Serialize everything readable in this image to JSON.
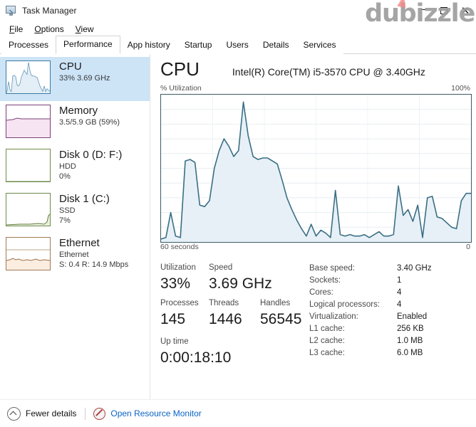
{
  "window": {
    "title": "Task Manager",
    "icon": "task-manager-icon",
    "controls": {
      "minimize": "–",
      "maximize": "❑",
      "close": "✕"
    },
    "watermark": "dubizzle"
  },
  "menu": {
    "items": [
      {
        "label": "File",
        "accel": "F"
      },
      {
        "label": "Options",
        "accel": "O"
      },
      {
        "label": "View",
        "accel": "V"
      }
    ]
  },
  "tabs": [
    {
      "label": "Processes",
      "selected": false
    },
    {
      "label": "Performance",
      "selected": true
    },
    {
      "label": "App history",
      "selected": false
    },
    {
      "label": "Startup",
      "selected": false
    },
    {
      "label": "Users",
      "selected": false
    },
    {
      "label": "Details",
      "selected": false
    },
    {
      "label": "Services",
      "selected": false
    }
  ],
  "sidebar": {
    "items": [
      {
        "name": "CPU",
        "line1": "33%  3.69 GHz",
        "line2": "",
        "selected": true,
        "color": "#3a7ca5",
        "fill": "#e6f0f8",
        "border": "#3a7ca5"
      },
      {
        "name": "Memory",
        "line1": "3.5/5.9 GB (59%)",
        "line2": "",
        "selected": false,
        "color": "#7a3f7a",
        "fill": "#f7e9f5",
        "border": "#7a3f7a"
      },
      {
        "name": "Disk 0 (D: F:)",
        "line1": "HDD",
        "line2": "0%",
        "selected": false,
        "color": "#5f7a3a",
        "fill": "#eef3e6",
        "border": "#6f8a4a"
      },
      {
        "name": "Disk 1 (C:)",
        "line1": "SSD",
        "line2": "7%",
        "selected": false,
        "color": "#5f7a3a",
        "fill": "#eef3e6",
        "border": "#6f8a4a"
      },
      {
        "name": "Ethernet",
        "line1": "Ethernet",
        "line2": "S: 0.4 R: 14.9 Mbps",
        "selected": false,
        "color": "#9c6f4a",
        "fill": "#fbf0e6",
        "border": "#a07c57"
      }
    ]
  },
  "detail": {
    "title": "CPU",
    "model": "Intel(R) Core(TM) i5-3570 CPU @ 3.40GHz",
    "chart_axis": {
      "y_label": "% Utilization",
      "y_max": "100%",
      "x_left": "60 seconds",
      "x_right": "0"
    },
    "stats": [
      {
        "label": "Utilization",
        "value": "33%"
      },
      {
        "label": "Speed",
        "value": "3.69 GHz"
      },
      {
        "label": "Processes",
        "value": "145"
      },
      {
        "label": "Threads",
        "value": "1446"
      },
      {
        "label": "Handles",
        "value": "56545"
      },
      {
        "label": "Up time",
        "value": "0:00:18:10"
      }
    ],
    "specs": [
      {
        "key": "Base speed:",
        "value": "3.40 GHz"
      },
      {
        "key": "Sockets:",
        "value": "1"
      },
      {
        "key": "Cores:",
        "value": "4"
      },
      {
        "key": "Logical processors:",
        "value": "4"
      },
      {
        "key": "Virtualization:",
        "value": "Enabled"
      },
      {
        "key": "L1 cache:",
        "value": "256 KB"
      },
      {
        "key": "L2 cache:",
        "value": "1.0 MB"
      },
      {
        "key": "L3 cache:",
        "value": "6.0 MB"
      }
    ]
  },
  "statusbar": {
    "fewer_details": "Fewer details",
    "open_resource_monitor": "Open Resource Monitor"
  },
  "colors": {
    "accent_line": "#3a6f84",
    "accent_fill": "#e7f0f7",
    "selection": "#cde4f7",
    "link": "#0b64c4",
    "grid": "#e8eef1"
  },
  "chart_data": {
    "type": "area",
    "title": "CPU % Utilization",
    "xlabel": "60 seconds",
    "ylabel": "% Utilization",
    "ylim": [
      0,
      100
    ],
    "xlim": [
      0,
      60
    ],
    "grid": true,
    "legend": null,
    "series": [
      {
        "name": "CPU Utilization",
        "line_color": "#3a6f84",
        "fill_color": "#e7f0f7",
        "values": [
          2,
          3,
          20,
          4,
          3,
          55,
          56,
          54,
          25,
          24,
          28,
          50,
          62,
          70,
          65,
          58,
          62,
          95,
          72,
          58,
          56,
          57,
          57,
          55,
          53,
          42,
          30,
          22,
          15,
          9,
          4,
          12,
          4,
          8,
          6,
          3,
          35,
          5,
          4,
          5,
          4,
          4,
          5,
          3,
          5,
          7,
          4,
          4,
          5,
          38,
          18,
          22,
          14,
          25,
          3,
          30,
          31,
          17,
          16,
          13,
          10,
          9,
          28,
          33,
          33
        ]
      }
    ]
  }
}
